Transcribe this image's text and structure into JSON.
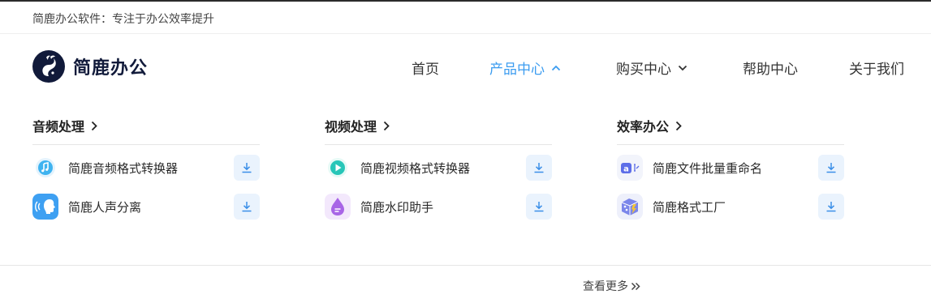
{
  "topbar": {
    "slogan": "简鹿办公软件：专注于办公效率提升"
  },
  "logo": {
    "text": "简鹿办公",
    "icon": "deer-logo-icon"
  },
  "nav": {
    "home": "首页",
    "products": "产品中心",
    "buy": "购买中心",
    "help": "帮助中心",
    "about": "关于我们"
  },
  "colors": {
    "accent": "#3b9cf0",
    "download_bg": "#eaf3fd",
    "logo_dark": "#111a3a"
  },
  "columns": [
    {
      "title": "音频处理",
      "items": [
        {
          "name": "简鹿音频格式转换器",
          "icon": "audio-converter-icon"
        },
        {
          "name": "简鹿人声分离",
          "icon": "voice-separation-icon"
        }
      ]
    },
    {
      "title": "视频处理",
      "items": [
        {
          "name": "简鹿视频格式转换器",
          "icon": "video-converter-icon"
        },
        {
          "name": "简鹿水印助手",
          "icon": "watermark-icon"
        }
      ]
    },
    {
      "title": "效率办公",
      "items": [
        {
          "name": "简鹿文件批量重命名",
          "icon": "batch-rename-icon"
        },
        {
          "name": "简鹿格式工厂",
          "icon": "format-factory-icon"
        }
      ]
    }
  ],
  "footer": {
    "more": "查看更多"
  }
}
